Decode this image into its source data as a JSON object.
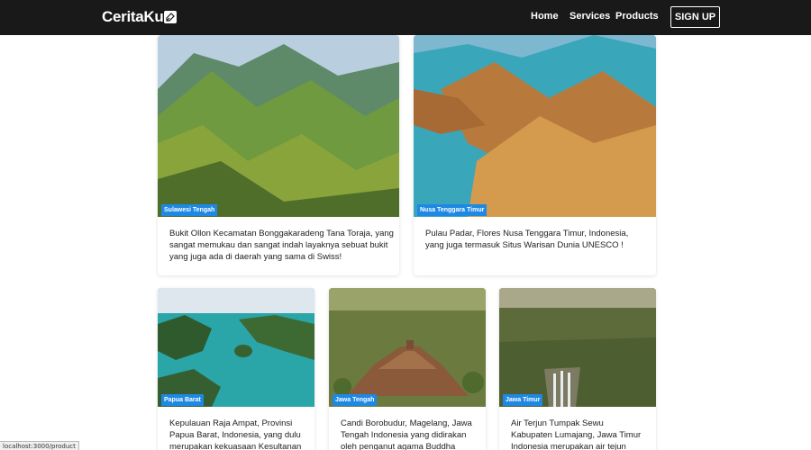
{
  "navbar": {
    "brand": "CeritaKu",
    "links": [
      "Home",
      "Services",
      "Products"
    ],
    "signup": "SIGN UP"
  },
  "cards": [
    {
      "location": "Sulawesi Tengah",
      "description": "Bukit Ollon Kecamatan Bonggakaradeng Tana Toraja, yang sangat memukau dan sangat indah layaknya sebuat bukit yang juga ada di daerah yang sama di Swiss!"
    },
    {
      "location": "Nusa Tenggara Timur",
      "description": "Pulau Padar, Flores Nusa Tenggara Timur, Indonesia, yang juga termasuk Situs Warisan Dunia UNESCO !"
    },
    {
      "location": "Papua Barat",
      "description": "Kepulauan Raja Ampat, Provinsi Papua Barat, Indonesia, yang dulu merupakan kekuasaan Kesultanan Tidore ini"
    },
    {
      "location": "Jawa Tengah",
      "description": "Candi Borobudur, Magelang, Jawa Tengah Indonesia yang didirakan oleh penganut agama Buddha Mahayana"
    },
    {
      "location": "Jawa Timur",
      "description": "Air Terjun Tumpak Sewu Kabupaten Lumajang, Jawa Timur Indonesia merupakan air tejun terindah di pulau"
    }
  ],
  "status_bar": {
    "url": "localhost:3000/product"
  }
}
